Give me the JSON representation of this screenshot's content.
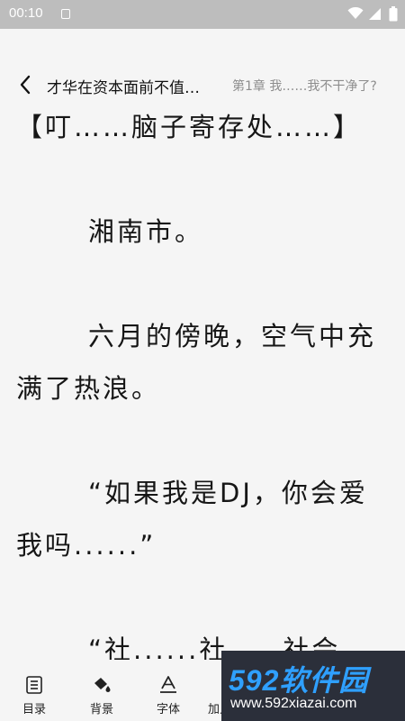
{
  "status_bar": {
    "time": "00:10"
  },
  "header": {
    "book_title": "才华在资本面前不值…",
    "chapter_title": "第1章 我……我不干净了?"
  },
  "content": {
    "paragraphs": [
      "【叮……脑子寄存处……】",
      "湘南市。",
      "六月的傍晚，空气中充满了热浪。",
      "“如果我是DJ，你会爱我吗......”",
      "“社......社.....社会"
    ]
  },
  "bottom_bar": {
    "items": [
      {
        "label": "目录",
        "icon": "list-icon"
      },
      {
        "label": "背景",
        "icon": "paint-bucket-icon"
      },
      {
        "label": "字体",
        "icon": "font-icon"
      },
      {
        "label": "加入书架",
        "icon": "bookshelf-icon"
      }
    ]
  },
  "watermark": {
    "logo": "592软件园",
    "url": "www.592xiazai.com"
  },
  "colors": {
    "background": "#f5f5f5",
    "status_bar": "#bdbdbd",
    "text": "#161616",
    "subtitle": "#8d8d8d",
    "watermark_bg": "#2b2f3a",
    "watermark_logo": "#2fa0ff"
  }
}
